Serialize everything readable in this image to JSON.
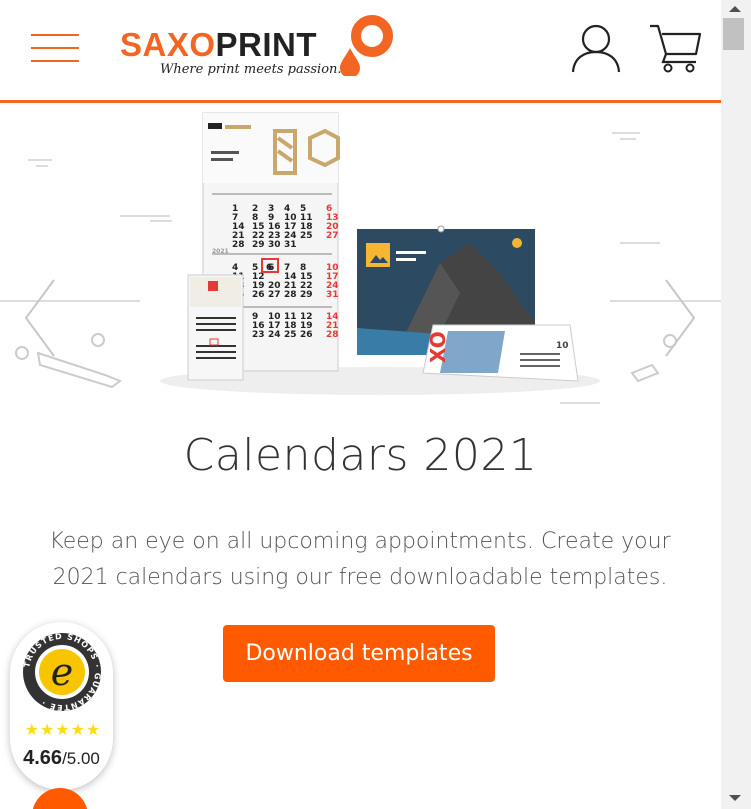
{
  "header": {
    "brand": {
      "part1": "SAXO",
      "part2": "PRINT",
      "tagline": "Where print meets passion."
    },
    "icons": {
      "menu": "hamburger-menu-icon",
      "account": "user-icon",
      "cart": "cart-icon"
    }
  },
  "hero": {
    "title": "Calendars 2021",
    "description": "Keep an eye on all upcoming appointments. Create your 2021 calendars using our free downloadable templates.",
    "cta_label": "Download templates",
    "calendar_visual": {
      "years": [
        "2021",
        "2021"
      ],
      "highlighted_day": "6",
      "desk_calendar_label": "10"
    }
  },
  "trusted_shops": {
    "badge_label": "TRUSTED SHOPS · GUARANTEE ·",
    "stars": "★★★★★",
    "score": "4.66",
    "max": "/5.00"
  },
  "colors": {
    "brand_orange": "#f26522",
    "cta_orange": "#ff5a00",
    "dark_text": "#333333"
  }
}
